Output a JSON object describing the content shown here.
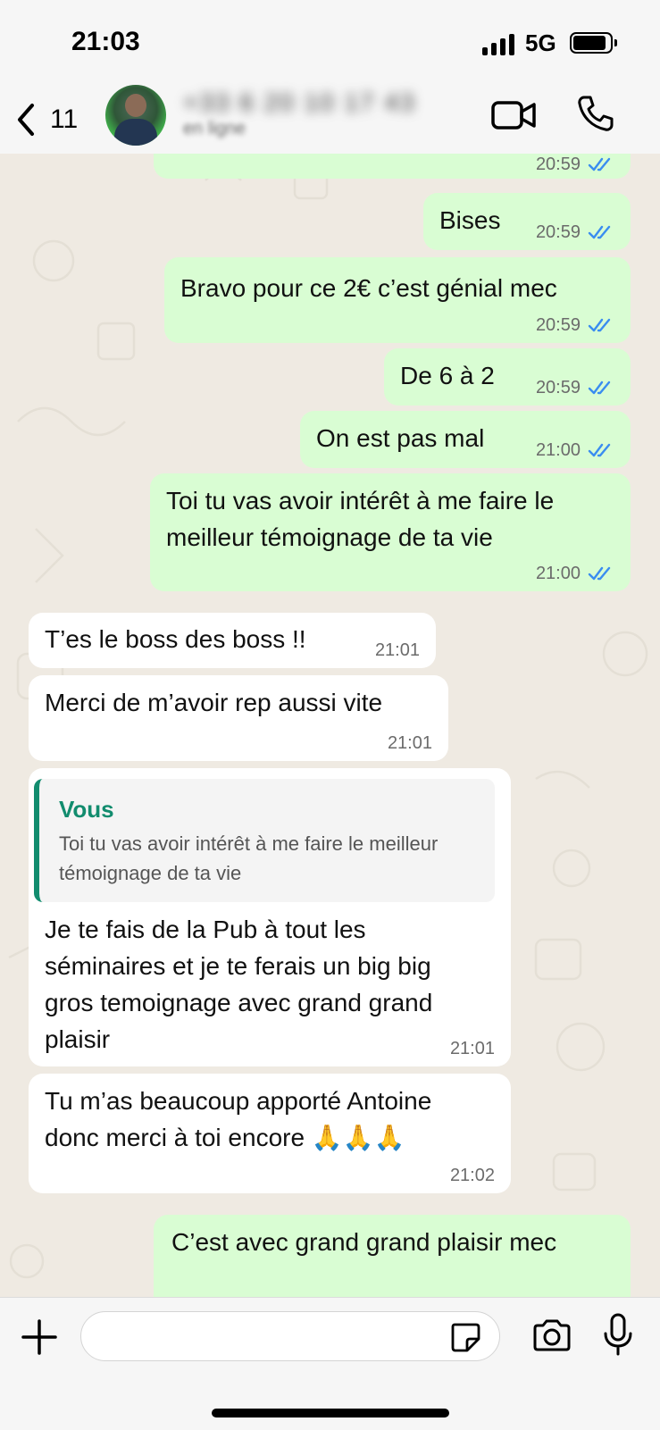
{
  "status_bar": {
    "time": "21:03",
    "network": "5G"
  },
  "header": {
    "back_count": "11",
    "contact_name": "+33 6 20 10 17 43",
    "contact_status": "en ligne"
  },
  "messages": [
    {
      "text": "",
      "time": "20:59",
      "ticks": "read"
    },
    {
      "text": "Bises",
      "time": "20:59",
      "ticks": "read"
    },
    {
      "text": "Bravo pour ce 2€ c’est génial mec",
      "time": "20:59",
      "ticks": "read"
    },
    {
      "text": "De 6 à 2",
      "time": "20:59",
      "ticks": "read"
    },
    {
      "text": "On est pas mal",
      "time": "21:00",
      "ticks": "read"
    },
    {
      "text": "Toi tu vas avoir intérêt à me faire le meilleur témoignage de ta vie",
      "time": "21:00",
      "ticks": "read"
    },
    {
      "text": "T’es le boss des boss !!",
      "time": "21:01"
    },
    {
      "text": "Merci de m’avoir rep aussi vite",
      "time": "21:01"
    },
    {
      "quote_author": "Vous",
      "quote_text": "Toi tu vas avoir intérêt à me faire le meilleur témoignage de ta vie",
      "text": "Je te fais de la Pub à tout les séminaires et je te ferais un big big gros temoignage avec grand grand plaisir",
      "time": "21:01"
    },
    {
      "text": "Tu m’as beaucoup apporté Antoine donc merci à toi encore 🙏🙏🙏",
      "time": "21:02"
    },
    {
      "text": "C’est avec grand grand plaisir mec"
    }
  ],
  "colors": {
    "outgoing_bubble": "#d9fdd3",
    "incoming_bubble": "#ffffff",
    "read_ticks": "#3a8df0",
    "quote_accent": "#128c6e",
    "chat_background": "#efeae2"
  },
  "icons": [
    "chevron-left-icon",
    "video-call-icon",
    "phone-icon",
    "plus-icon",
    "sticker-icon",
    "camera-icon",
    "microphone-icon",
    "double-check-icon"
  ]
}
